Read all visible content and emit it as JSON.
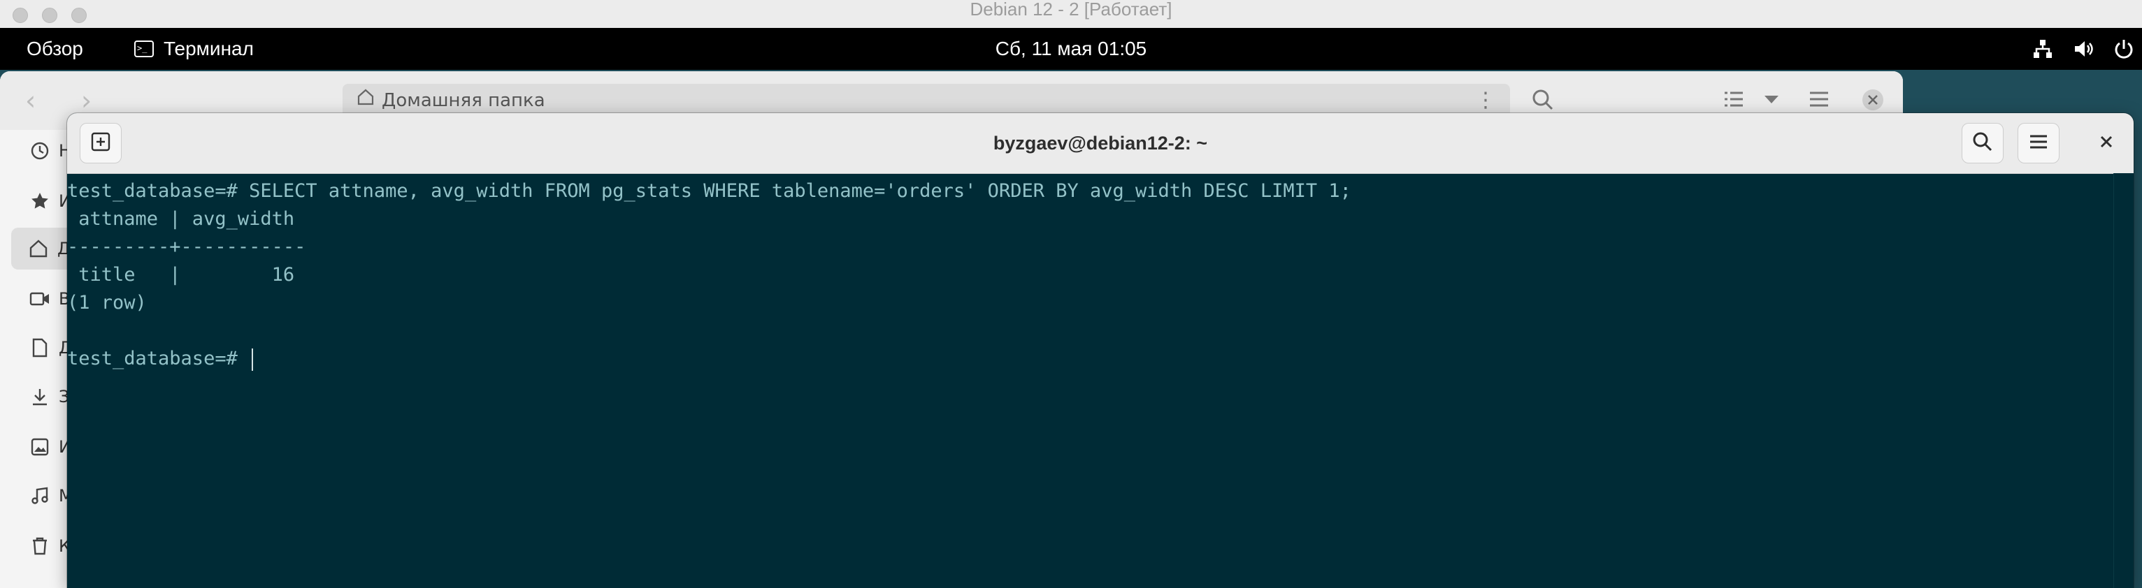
{
  "vm": {
    "title": "Debian 12 - 2 [Работает]"
  },
  "topbar": {
    "overview": "Обзор",
    "app_name": "Терминал",
    "clock": "Сб, 11 мая  01:05",
    "tray_icons": [
      "network-icon",
      "volume-icon",
      "power-icon"
    ]
  },
  "files": {
    "path": "Домашняя папка",
    "sidebar_letters": [
      "Н",
      "И",
      "Д",
      "В",
      "Д",
      "З",
      "И",
      "М",
      "К"
    ],
    "sidebar_icons": [
      "clock-icon",
      "star-icon",
      "home-icon",
      "video-icon",
      "document-icon",
      "download-icon",
      "image-icon",
      "music-icon",
      "trash-icon"
    ]
  },
  "terminal": {
    "title": "byzgaev@debian12-2: ~",
    "lines": [
      "test_database=# SELECT attname, avg_width FROM pg_stats WHERE tablename='orders' ORDER BY avg_width DESC LIMIT 1;",
      " attname | avg_width ",
      "---------+-----------",
      " title   |        16",
      "(1 row)",
      "",
      "test_database=# "
    ]
  },
  "colors": {
    "terminal_bg": "#002b36",
    "terminal_fg": "#93c2c8",
    "header_bg": "#ebebeb"
  }
}
